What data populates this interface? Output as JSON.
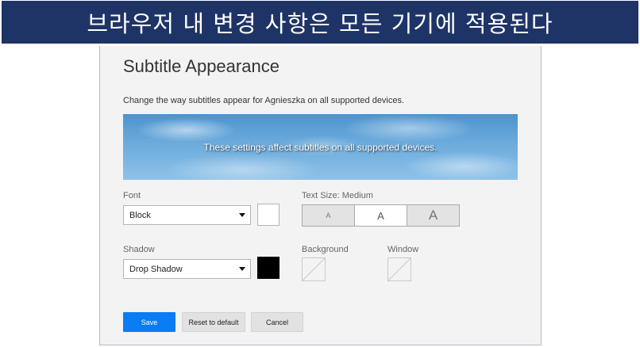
{
  "banner": {
    "text": "브라우저 내 변경 사항은 모든 기기에 적용된다"
  },
  "panel": {
    "title": "Subtitle Appearance",
    "description": "Change the way subtitles appear for Agnieszka on all supported devices.",
    "preview_text": "These settings affect subtitles on all supported devices."
  },
  "font": {
    "label": "Font",
    "selected": "Block",
    "color": "#ffffff"
  },
  "text_size": {
    "label": "Text Size: Medium",
    "options": [
      "A",
      "A",
      "A"
    ],
    "selected": "Medium"
  },
  "shadow": {
    "label": "Shadow",
    "selected": "Drop Shadow",
    "color": "#000000"
  },
  "background": {
    "label": "Background"
  },
  "window": {
    "label": "Window"
  },
  "buttons": {
    "save": "Save",
    "reset": "Reset to default",
    "cancel": "Cancel"
  },
  "colors": {
    "banner_bg": "#1f3466",
    "primary": "#0a7df5"
  }
}
